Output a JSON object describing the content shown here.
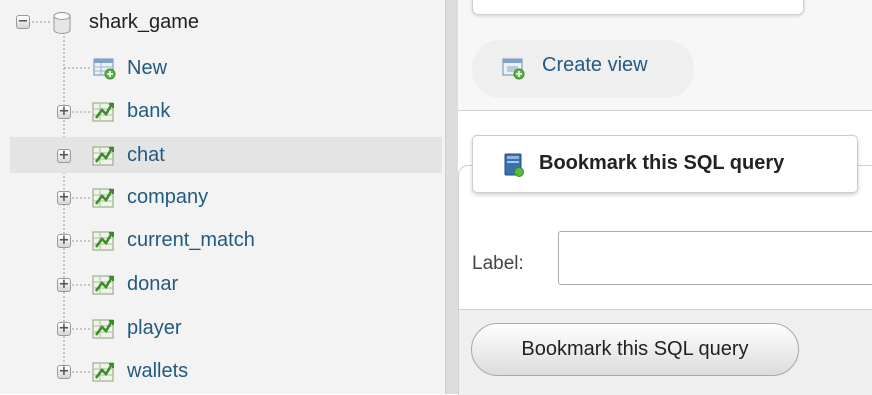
{
  "navigation": {
    "database": {
      "name": "shark_game",
      "expander": "−"
    },
    "new_item": {
      "label": "New"
    },
    "tables": [
      {
        "name": "bank"
      },
      {
        "name": "chat"
      },
      {
        "name": "company"
      },
      {
        "name": "current_match"
      },
      {
        "name": "donar"
      },
      {
        "name": "player"
      },
      {
        "name": "wallets"
      }
    ],
    "expander_symbol": "+"
  },
  "views": {
    "create_view_label": "Create view"
  },
  "bookmark": {
    "legend": "Bookmark this SQL query",
    "label_field_label": "Label:",
    "label_value": "",
    "submit_label": "Bookmark this SQL query"
  },
  "icons": {
    "database": "database-icon",
    "new": "new-table-icon",
    "table": "table-icon",
    "create_view": "create-view-icon",
    "bookmark": "bookmark-icon"
  },
  "colors": {
    "link": "#235a81",
    "nav_background": "#f3f3f3",
    "hover_row": "#e4e4e4"
  }
}
